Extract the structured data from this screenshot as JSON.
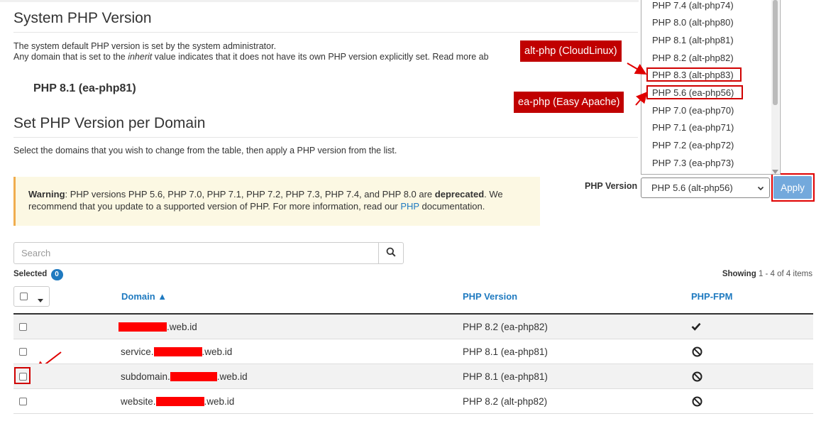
{
  "system_section": {
    "title": "System PHP Version",
    "desc_line1": "The system default PHP version is set by the system administrator.",
    "desc_line2_pre": "Any domain that is set to the ",
    "desc_line2_em": "inherit",
    "desc_line2_post": " value indicates that it does not have its own PHP version explicitly set. Read more ab",
    "default_version": "PHP 8.1 (ea-php81)"
  },
  "domain_section": {
    "title": "Set PHP Version per Domain",
    "instructions": "Select the domains that you wish to change from the table, then apply a PHP version from the list."
  },
  "warning": {
    "label": "Warning",
    "text_1": ": PHP versions PHP 5.6, PHP 7.0, PHP 7.1, PHP 7.2, PHP 7.3, PHP 7.4, and PHP 8.0 are ",
    "bold_word": "deprecated",
    "text_2": ". We recommend that you update to a supported version of PHP. For more information, read our ",
    "link": "PHP",
    "text_3": " documentation."
  },
  "php_selector": {
    "label": "PHP Version",
    "selected": "PHP 5.6 (alt-php56)",
    "apply_label": "Apply",
    "options": [
      "PHP 7.4 (alt-php74)",
      "PHP 8.0 (alt-php80)",
      "PHP 8.1 (alt-php81)",
      "PHP 8.2 (alt-php82)",
      "PHP 8.3 (alt-php83)",
      "PHP 5.6 (ea-php56)",
      "PHP 7.0 (ea-php70)",
      "PHP 7.1 (ea-php71)",
      "PHP 7.2 (ea-php72)",
      "PHP 7.3 (ea-php73)"
    ]
  },
  "annotations": {
    "alt_php": "alt-php (CloudLinux)",
    "ea_php": "ea-php (Easy Apache)",
    "color": "#c00000"
  },
  "search": {
    "placeholder": "Search"
  },
  "selection": {
    "label": "Selected",
    "count": "0"
  },
  "paging": {
    "showing_label": "Showing",
    "range": "1 - 4 of 4 items"
  },
  "table": {
    "headers": {
      "domain": "Domain ▲",
      "php_version": "PHP Version",
      "php_fpm": "PHP-FPM"
    },
    "rows": [
      {
        "domain_prefix": "",
        "domain_suffix": ".web.id",
        "php_version": "PHP 8.2 (ea-php82)",
        "fpm": "enabled",
        "fpm_icon": "checkmark-icon"
      },
      {
        "domain_prefix": "service.",
        "domain_suffix": ".web.id",
        "php_version": "PHP 8.1 (ea-php81)",
        "fpm": "disabled",
        "fpm_icon": "ban-icon"
      },
      {
        "domain_prefix": "subdomain.",
        "domain_suffix": ".web.id",
        "php_version": "PHP 8.1 (ea-php81)",
        "fpm": "disabled",
        "fpm_icon": "ban-icon"
      },
      {
        "domain_prefix": "website.",
        "domain_suffix": ".web.id",
        "php_version": "PHP 8.2 (alt-php82)",
        "fpm": "disabled",
        "fpm_icon": "ban-icon"
      }
    ]
  },
  "colors": {
    "accent": "#1f7ac0",
    "apply_button": "#73a9dc",
    "warning_bg": "#fcf8e3",
    "warning_border": "#f0ad4e",
    "redaction": "#ff0000"
  }
}
